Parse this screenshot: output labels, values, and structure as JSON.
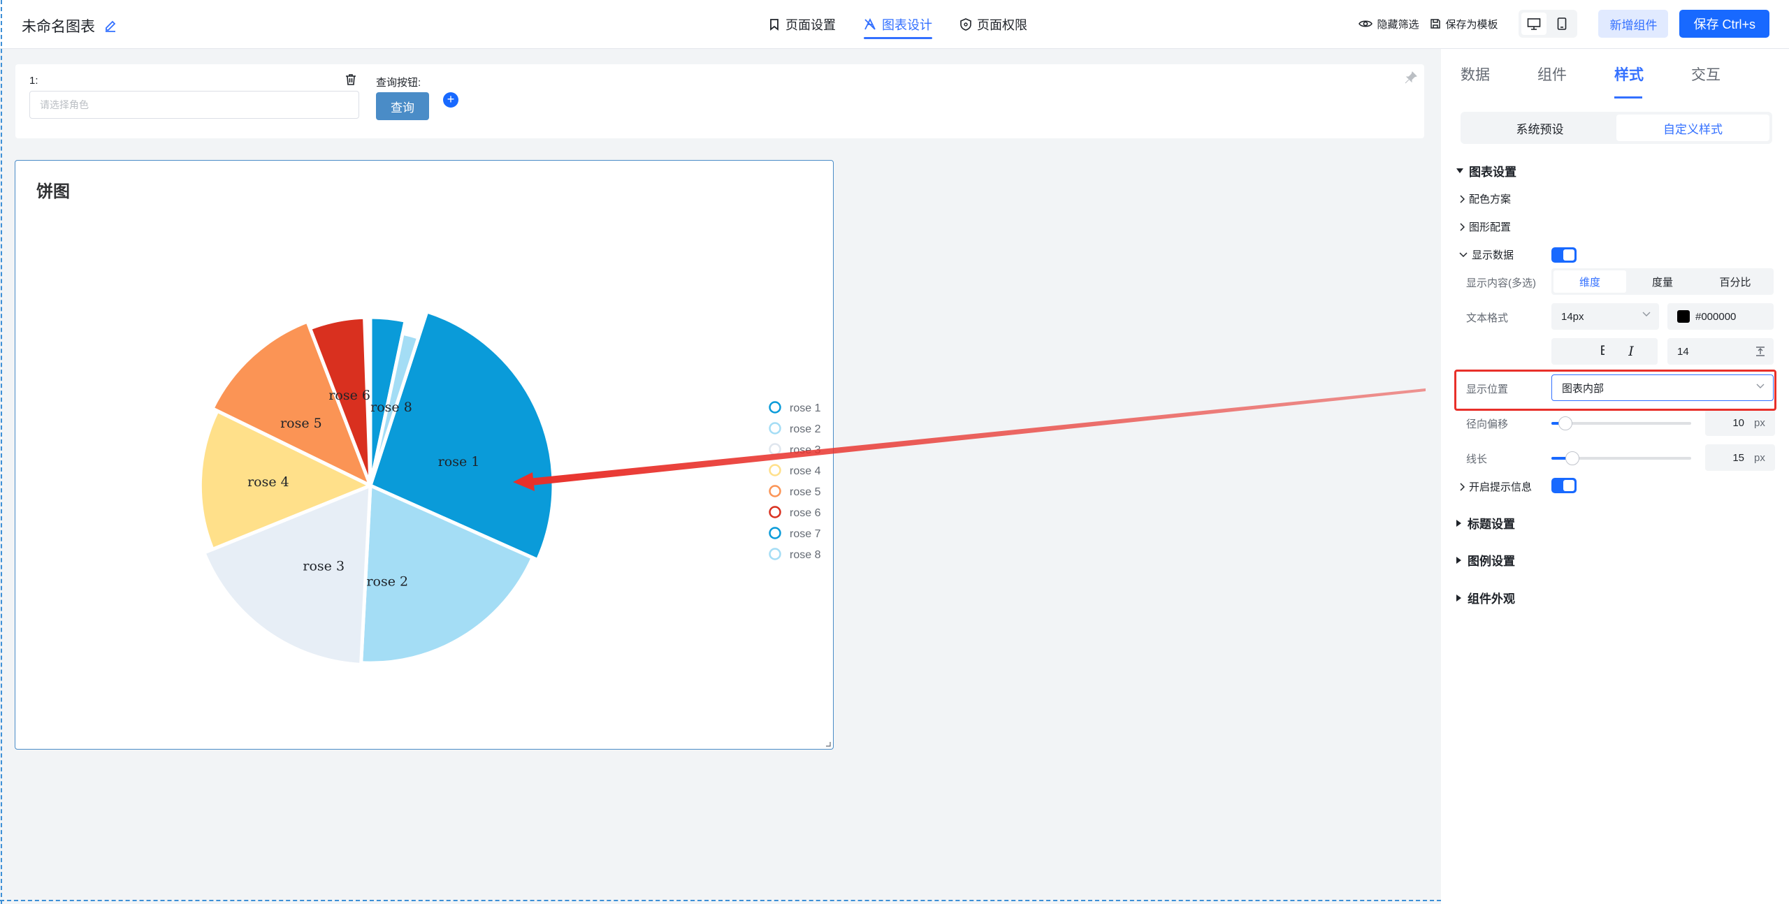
{
  "header": {
    "title": "未命名图表",
    "tabs": [
      {
        "label": "页面设置",
        "icon": "bookmark-icon"
      },
      {
        "label": "图表设计",
        "icon": "design-icon"
      },
      {
        "label": "页面权限",
        "icon": "shield-icon"
      }
    ],
    "hide_filter": "隐藏筛选",
    "save_template": "保存为模板",
    "add_component": "新增组件",
    "save": "保存 Ctrl+s"
  },
  "query": {
    "field_label": "1:",
    "placeholder": "请选择角色",
    "button_label": "查询按钮:",
    "button": "查询"
  },
  "chart_card": {
    "title": "饼图"
  },
  "chart_data": {
    "type": "pie",
    "style": "nightingale-rose",
    "categories": [
      "rose 1",
      "rose 2",
      "rose 3",
      "rose 4",
      "rose 5",
      "rose 6",
      "rose 7",
      "rose 8"
    ],
    "values": [
      22,
      20,
      18,
      16,
      14,
      12,
      10,
      8
    ],
    "colors": [
      "#0a9bd9",
      "#a4ddf5",
      "#e7eef6",
      "#ffe08a",
      "#fb9455",
      "#d9301f",
      "#0a9bd9",
      "#a4ddf5"
    ],
    "labels_inside": [
      "rose 1",
      "rose 2",
      "rose 3",
      "rose 4",
      "rose 5",
      "rose 6",
      "rose 8"
    ],
    "legend_position": "right",
    "legend": [
      "rose 1",
      "rose 2",
      "rose 3",
      "rose 4",
      "rose 5",
      "rose 6",
      "rose 7",
      "rose 8"
    ]
  },
  "panel": {
    "tabs": [
      "数据",
      "组件",
      "样式",
      "交互"
    ],
    "preset_tabs": [
      "系统预设",
      "自定义样式"
    ],
    "chart_settings": "图表设置",
    "color_scheme": "配色方案",
    "shape_config": "图形配置",
    "show_data": "显示数据",
    "show_content_label": "显示内容(多选)",
    "content_options": [
      "维度",
      "度量",
      "百分比"
    ],
    "text_format_label": "文本格式",
    "font_size": "14px",
    "color_value": "#000000",
    "bold": "B",
    "italic": "I",
    "line_height": "14",
    "position_label": "显示位置",
    "position_value": "图表内部",
    "radial_offset_label": "径向偏移",
    "radial_offset": "10",
    "line_length_label": "线长",
    "line_length": "15",
    "unit": "px",
    "tooltip": "开启提示信息",
    "title_settings": "标题设置",
    "legend_settings": "图例设置",
    "appearance": "组件外观"
  }
}
